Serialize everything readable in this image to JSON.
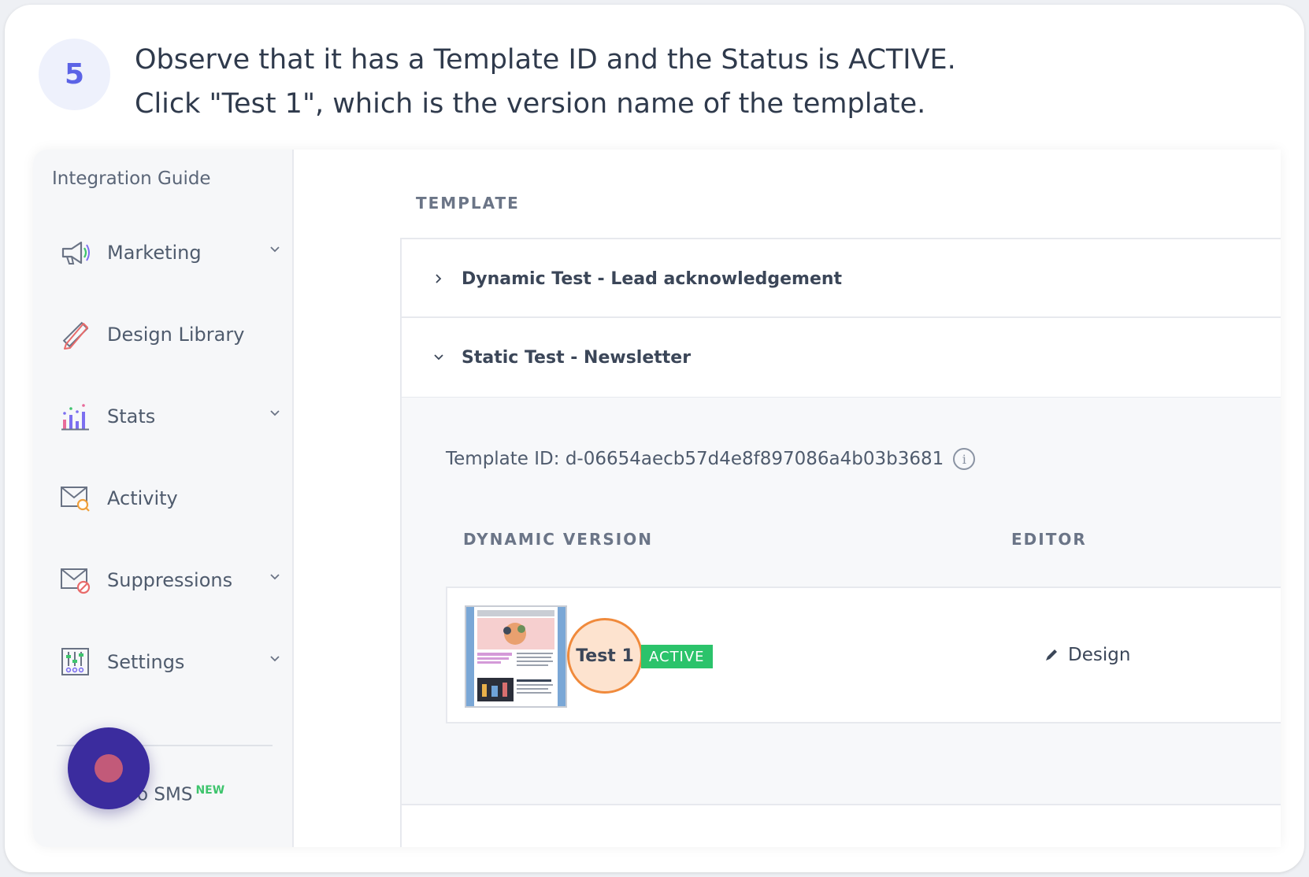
{
  "step": {
    "number": "5",
    "line1": "Observe that it has a Template ID and the Status is ACTIVE.",
    "line2": "Click \"Test 1\", which is the version name of the template."
  },
  "sidebar": {
    "header": "Integration Guide",
    "items": [
      {
        "label": "Marketing",
        "icon": "megaphone-icon",
        "has_chevron": true
      },
      {
        "label": "Design Library",
        "icon": "pencil-ruler-icon",
        "has_chevron": false
      },
      {
        "label": "Stats",
        "icon": "bar-chart-icon",
        "has_chevron": true
      },
      {
        "label": "Activity",
        "icon": "envelope-search-icon",
        "has_chevron": false
      },
      {
        "label": "Suppressions",
        "icon": "envelope-block-icon",
        "has_chevron": true
      },
      {
        "label": "Settings",
        "icon": "sliders-icon",
        "has_chevron": true
      }
    ],
    "sms_label": "o SMS",
    "sms_badge": "NEW"
  },
  "main": {
    "section_label": "TEMPLATE",
    "templates": [
      {
        "name": "Dynamic Test - Lead acknowledgement",
        "expanded": false
      },
      {
        "name": "Static Test - Newsletter",
        "expanded": true
      }
    ],
    "template_id": "Template ID: d-06654aecb57d4e8f897086a4b03b3681",
    "info_icon_glyph": "i",
    "columns": {
      "version": "DYNAMIC VERSION",
      "editor": "EDITOR"
    },
    "version": {
      "name": "Test 1",
      "status": "ACTIVE",
      "editor": "Design"
    }
  },
  "colors": {
    "accent": "#5b63e6",
    "active_green": "#2bc36b",
    "highlight_orange": "#f08a3c",
    "fab_purple": "#3b2c9e"
  }
}
